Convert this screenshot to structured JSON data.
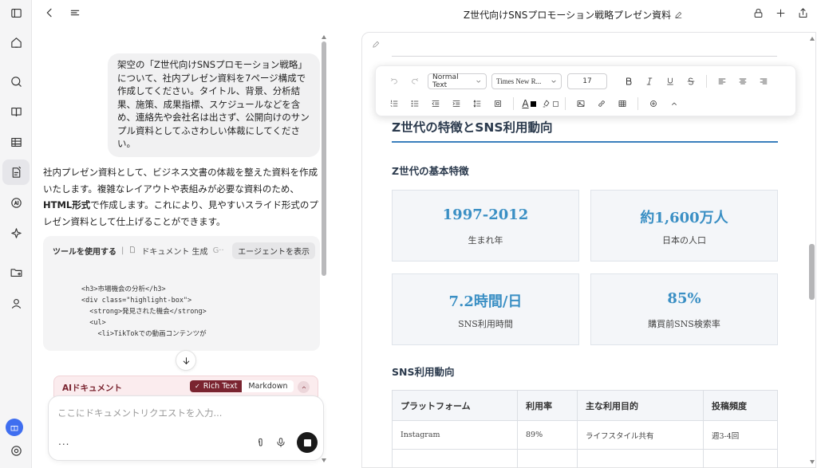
{
  "window": {
    "title": "Z世代向けSNSプロモーション戦略プレゼン資料"
  },
  "chat": {
    "user_message": "架空の「Z世代向けSNSプロモーション戦略」について、社内プレゼン資料を7ページ構成で作成してください。タイトル、背景、分析結果、施策、成果指標、スケジュールなどを含め、連絡先や会社名は出さず、公開向けのサンプル資料としてふさわしい体裁にしてください。",
    "assistant_message": {
      "part1": "社内プレゼン資料として、ビジネス文書の体裁を整えた資料を作成いたします。複雑なレイアウトや表組みが必要な資料のため、",
      "bold": "HTML形式",
      "part2": "で作成します。これにより、見やすいスライド形式のプレゼン資料として仕上げることができます。"
    },
    "tool_card": {
      "title": "ツールを使用する",
      "separator": "|",
      "action": "ドキュメント 生成",
      "truncated": "G··",
      "agent_button": "エージェントを表示",
      "code_lines": [
        "<h3>市場機会の分析</h3>",
        "<div class=\"highlight-box\">",
        "  <strong>発見された機会</strong>",
        "  <ul>",
        "    <li>TikTokでの動画コンテンツが"
      ]
    },
    "doc_mode": {
      "label": "AIドキュメント",
      "rich_text": "Rich Text",
      "markdown": "Markdown"
    },
    "composer": {
      "placeholder": "ここにドキュメントリクエストを入力...",
      "more": "..."
    }
  },
  "toolbar": {
    "paragraph_style": "Normal Text",
    "font_family": "Times New R...",
    "font_size": "17",
    "text_color_label": "A"
  },
  "document": {
    "section_title": "Z世代の特徴とSNS利用動向",
    "subsection1": "Z世代の基本特徴",
    "stats": [
      {
        "value": "1997-2012",
        "label": "生まれ年"
      },
      {
        "value": "約1,600万人",
        "label": "日本の人口"
      },
      {
        "value": "7.2時間/日",
        "label": "SNS利用時間"
      },
      {
        "value": "85%",
        "label": "購買前SNS検索率"
      }
    ],
    "subsection2": "SNS利用動向",
    "table": {
      "headers": [
        "プラットフォーム",
        "利用率",
        "主な利用目的",
        "投稿頻度"
      ],
      "rows": [
        [
          "Instagram",
          "89%",
          "ライフスタイル共有",
          "週3-4回"
        ],
        [
          "",
          "",
          "",
          ""
        ]
      ]
    }
  },
  "colors": {
    "accent_blue": "#3a8fc4",
    "doc_mode_red": "#7a2430",
    "rail_badge": "#3f6ef0"
  }
}
